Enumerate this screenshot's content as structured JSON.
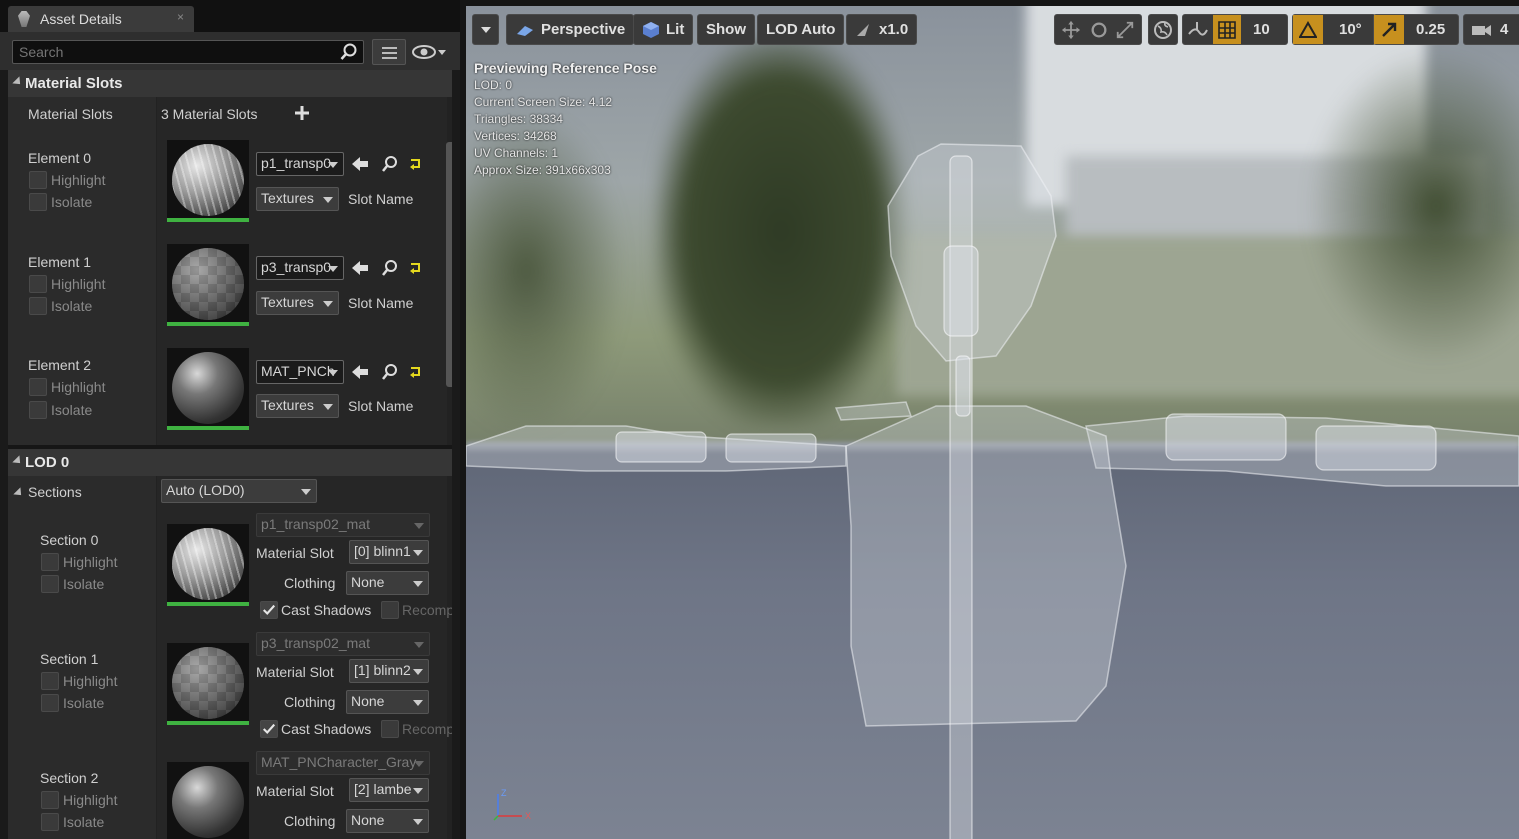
{
  "panel": {
    "tab_label": "Asset Details",
    "search_placeholder": "Search",
    "material_slots_header": "Material Slots",
    "material_slots_label": "Material Slots",
    "material_slots_count": "3 Material Slots",
    "elements": [
      {
        "label": "Element 0",
        "material": "p1_transp0",
        "textures": "Textures",
        "slot_name": "Slot Name",
        "highlight": "Highlight",
        "isolate": "Isolate"
      },
      {
        "label": "Element 1",
        "material": "p3_transp0",
        "textures": "Textures",
        "slot_name": "Slot Name",
        "highlight": "Highlight",
        "isolate": "Isolate"
      },
      {
        "label": "Element 2",
        "material": "MAT_PNCh",
        "textures": "Textures",
        "slot_name": "Slot Name",
        "highlight": "Highlight",
        "isolate": "Isolate"
      }
    ],
    "lod_header": "LOD 0",
    "sections_label": "Sections",
    "lod_select": "Auto (LOD0)",
    "sections": [
      {
        "label": "Section 0",
        "material": "p1_transp02_mat",
        "slot_label": "Material Slot",
        "slot": "[0] blinn1",
        "clothing_label": "Clothing",
        "clothing": "None",
        "cast_shadows": "Cast Shadows",
        "recompute": "Recomp",
        "highlight": "Highlight",
        "isolate": "Isolate"
      },
      {
        "label": "Section 1",
        "material": "p3_transp02_mat",
        "slot_label": "Material Slot",
        "slot": "[1] blinn2",
        "clothing_label": "Clothing",
        "clothing": "None",
        "cast_shadows": "Cast Shadows",
        "recompute": "Recomp",
        "highlight": "Highlight",
        "isolate": "Isolate"
      },
      {
        "label": "Section 2",
        "material": "MAT_PNCharacter_Gray",
        "slot_label": "Material Slot",
        "slot": "[2] lambe",
        "clothing_label": "Clothing",
        "clothing": "None",
        "highlight": "Highlight",
        "isolate": "Isolate"
      }
    ]
  },
  "viewport": {
    "perspective": "Perspective",
    "lit": "Lit",
    "show": "Show",
    "lod": "LOD Auto",
    "speed": "x1.0",
    "grid": "10",
    "angle": "10°",
    "scale": "0.25",
    "camera": "4",
    "stats_header": "Previewing Reference Pose",
    "stats": [
      "LOD: 0",
      "Current Screen Size: 4.12",
      "Triangles: 38334",
      "Vertices: 34268",
      "UV Channels: 1",
      "Approx Size: 391x66x303"
    ],
    "axis": {
      "z": "Z",
      "x": "X"
    }
  },
  "colors": {
    "accent_green": "#3fb241",
    "highlight_orange": "#c7901e",
    "lit_blue": "#5a7fd0"
  }
}
